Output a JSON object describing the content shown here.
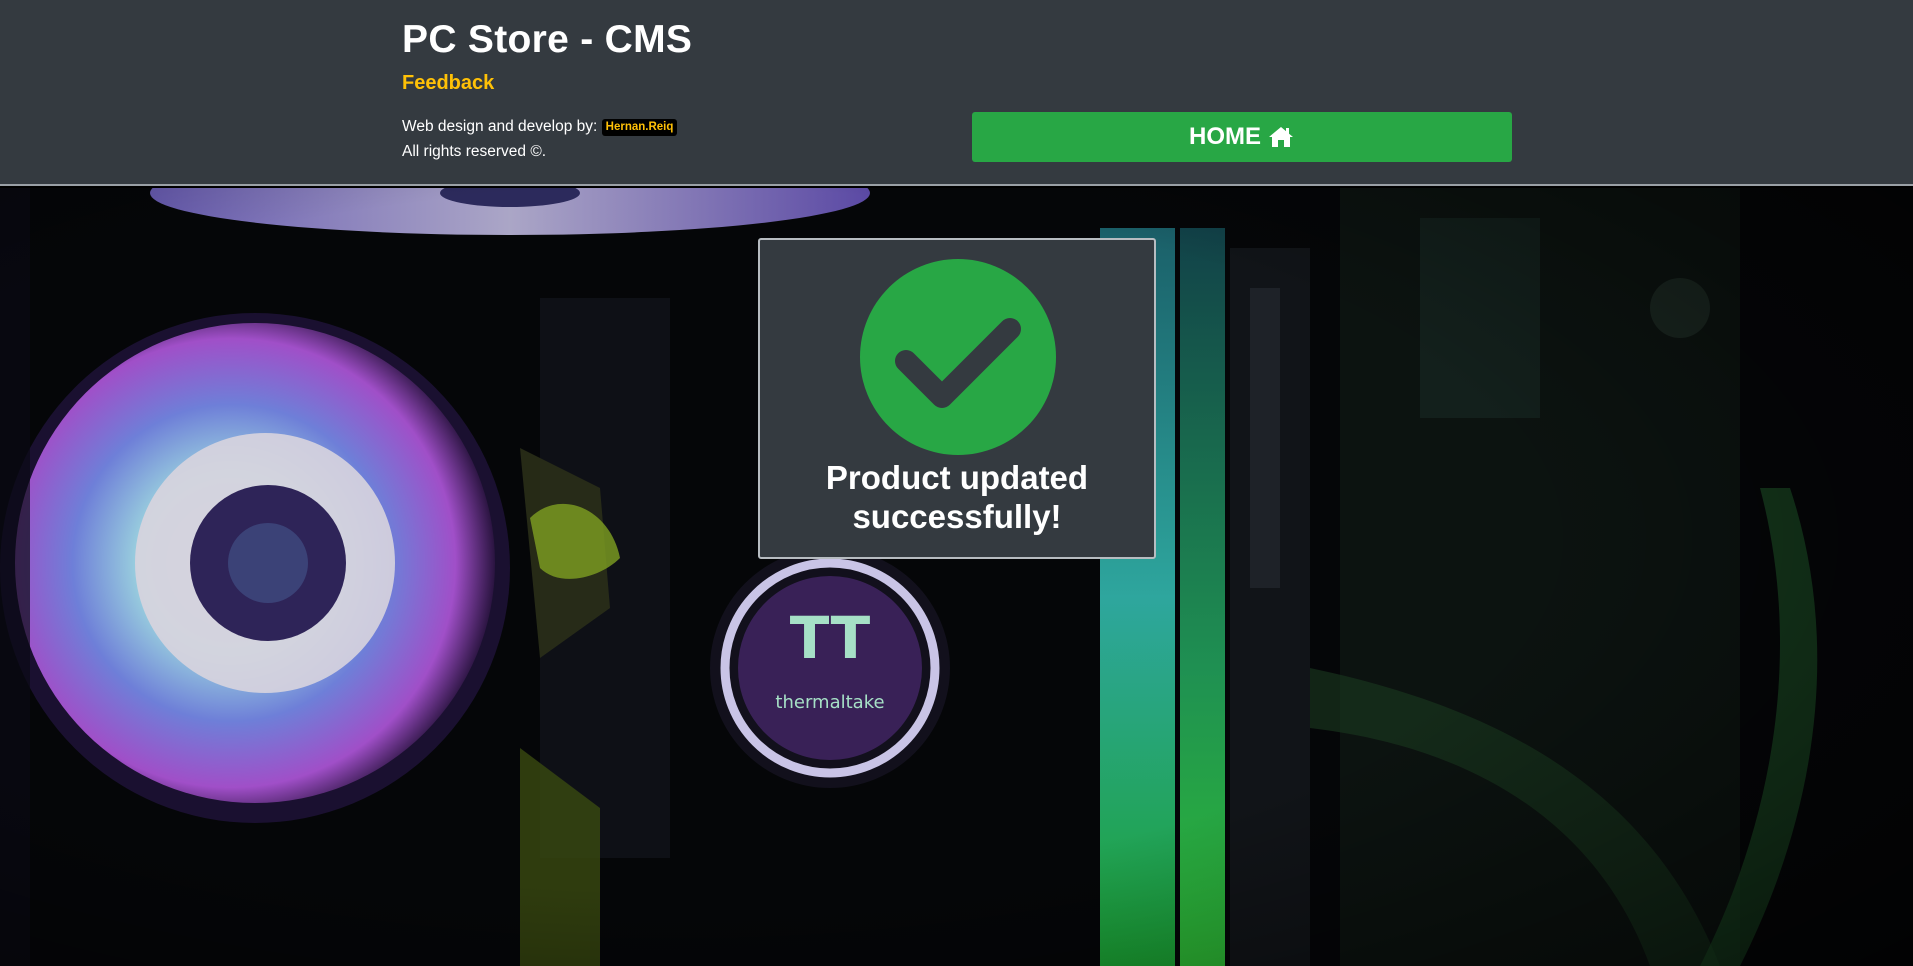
{
  "header": {
    "title": "PC Store - CMS",
    "feedback_label": "Feedback",
    "credits_prefix": "Web design and develop by:",
    "author": "Hernan.Reiq",
    "rights": "All rights reserved ©.",
    "home_label": "HOME",
    "home_icon": "home-icon"
  },
  "modal": {
    "icon": "check-circle-icon",
    "message": "Product updated successfully!"
  },
  "colors": {
    "header_bg": "#343a40",
    "accent_yellow": "#ffc107",
    "success_green": "#28a745"
  }
}
